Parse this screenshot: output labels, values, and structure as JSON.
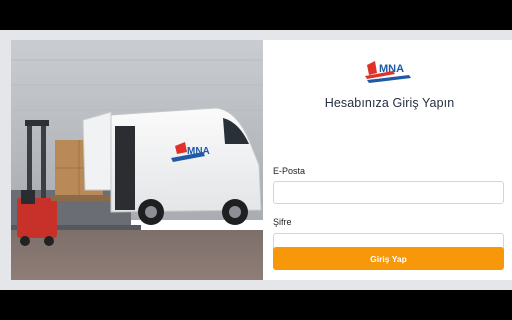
{
  "brand": {
    "logo_text": "MNA"
  },
  "login": {
    "title": "Hesabınıza Giriş Yapın",
    "email_label": "E-Posta",
    "email_value": "",
    "password_label": "Şifre",
    "password_value": "",
    "submit_label": "Giriş Yap"
  },
  "colors": {
    "accent": "#f7980b",
    "logo_red": "#e0312a",
    "logo_blue": "#1f5aa6"
  }
}
